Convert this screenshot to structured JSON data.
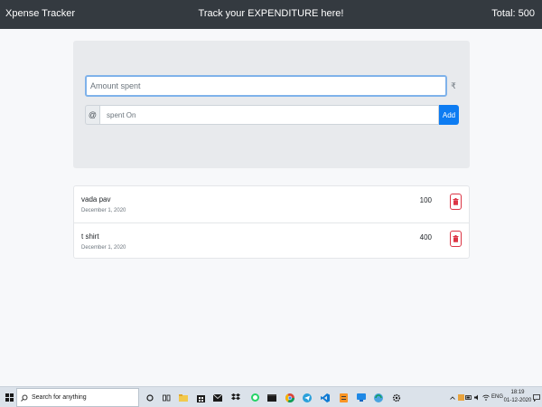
{
  "navbar": {
    "brand": "Xpense Tracker",
    "tagline": "Track your EXPENDITURE here!",
    "total": "Total: 500"
  },
  "form": {
    "amount_placeholder": "Amount spent",
    "currency_symbol": "₹",
    "at_symbol": "@",
    "spent_on_placeholder": "spent On",
    "add_label": "Add"
  },
  "expenses": [
    {
      "name": "vada pav",
      "date": "December 1, 2020",
      "amount": "100"
    },
    {
      "name": "t shirt",
      "date": "December 1, 2020",
      "amount": "400"
    }
  ],
  "taskbar": {
    "search_placeholder": "Search for anything",
    "language": "ENG",
    "time": "18:19",
    "date": "01-12-2020"
  },
  "colors": {
    "navbar": "#343a40",
    "primary": "#0d7cf2",
    "danger": "#dc3545"
  }
}
